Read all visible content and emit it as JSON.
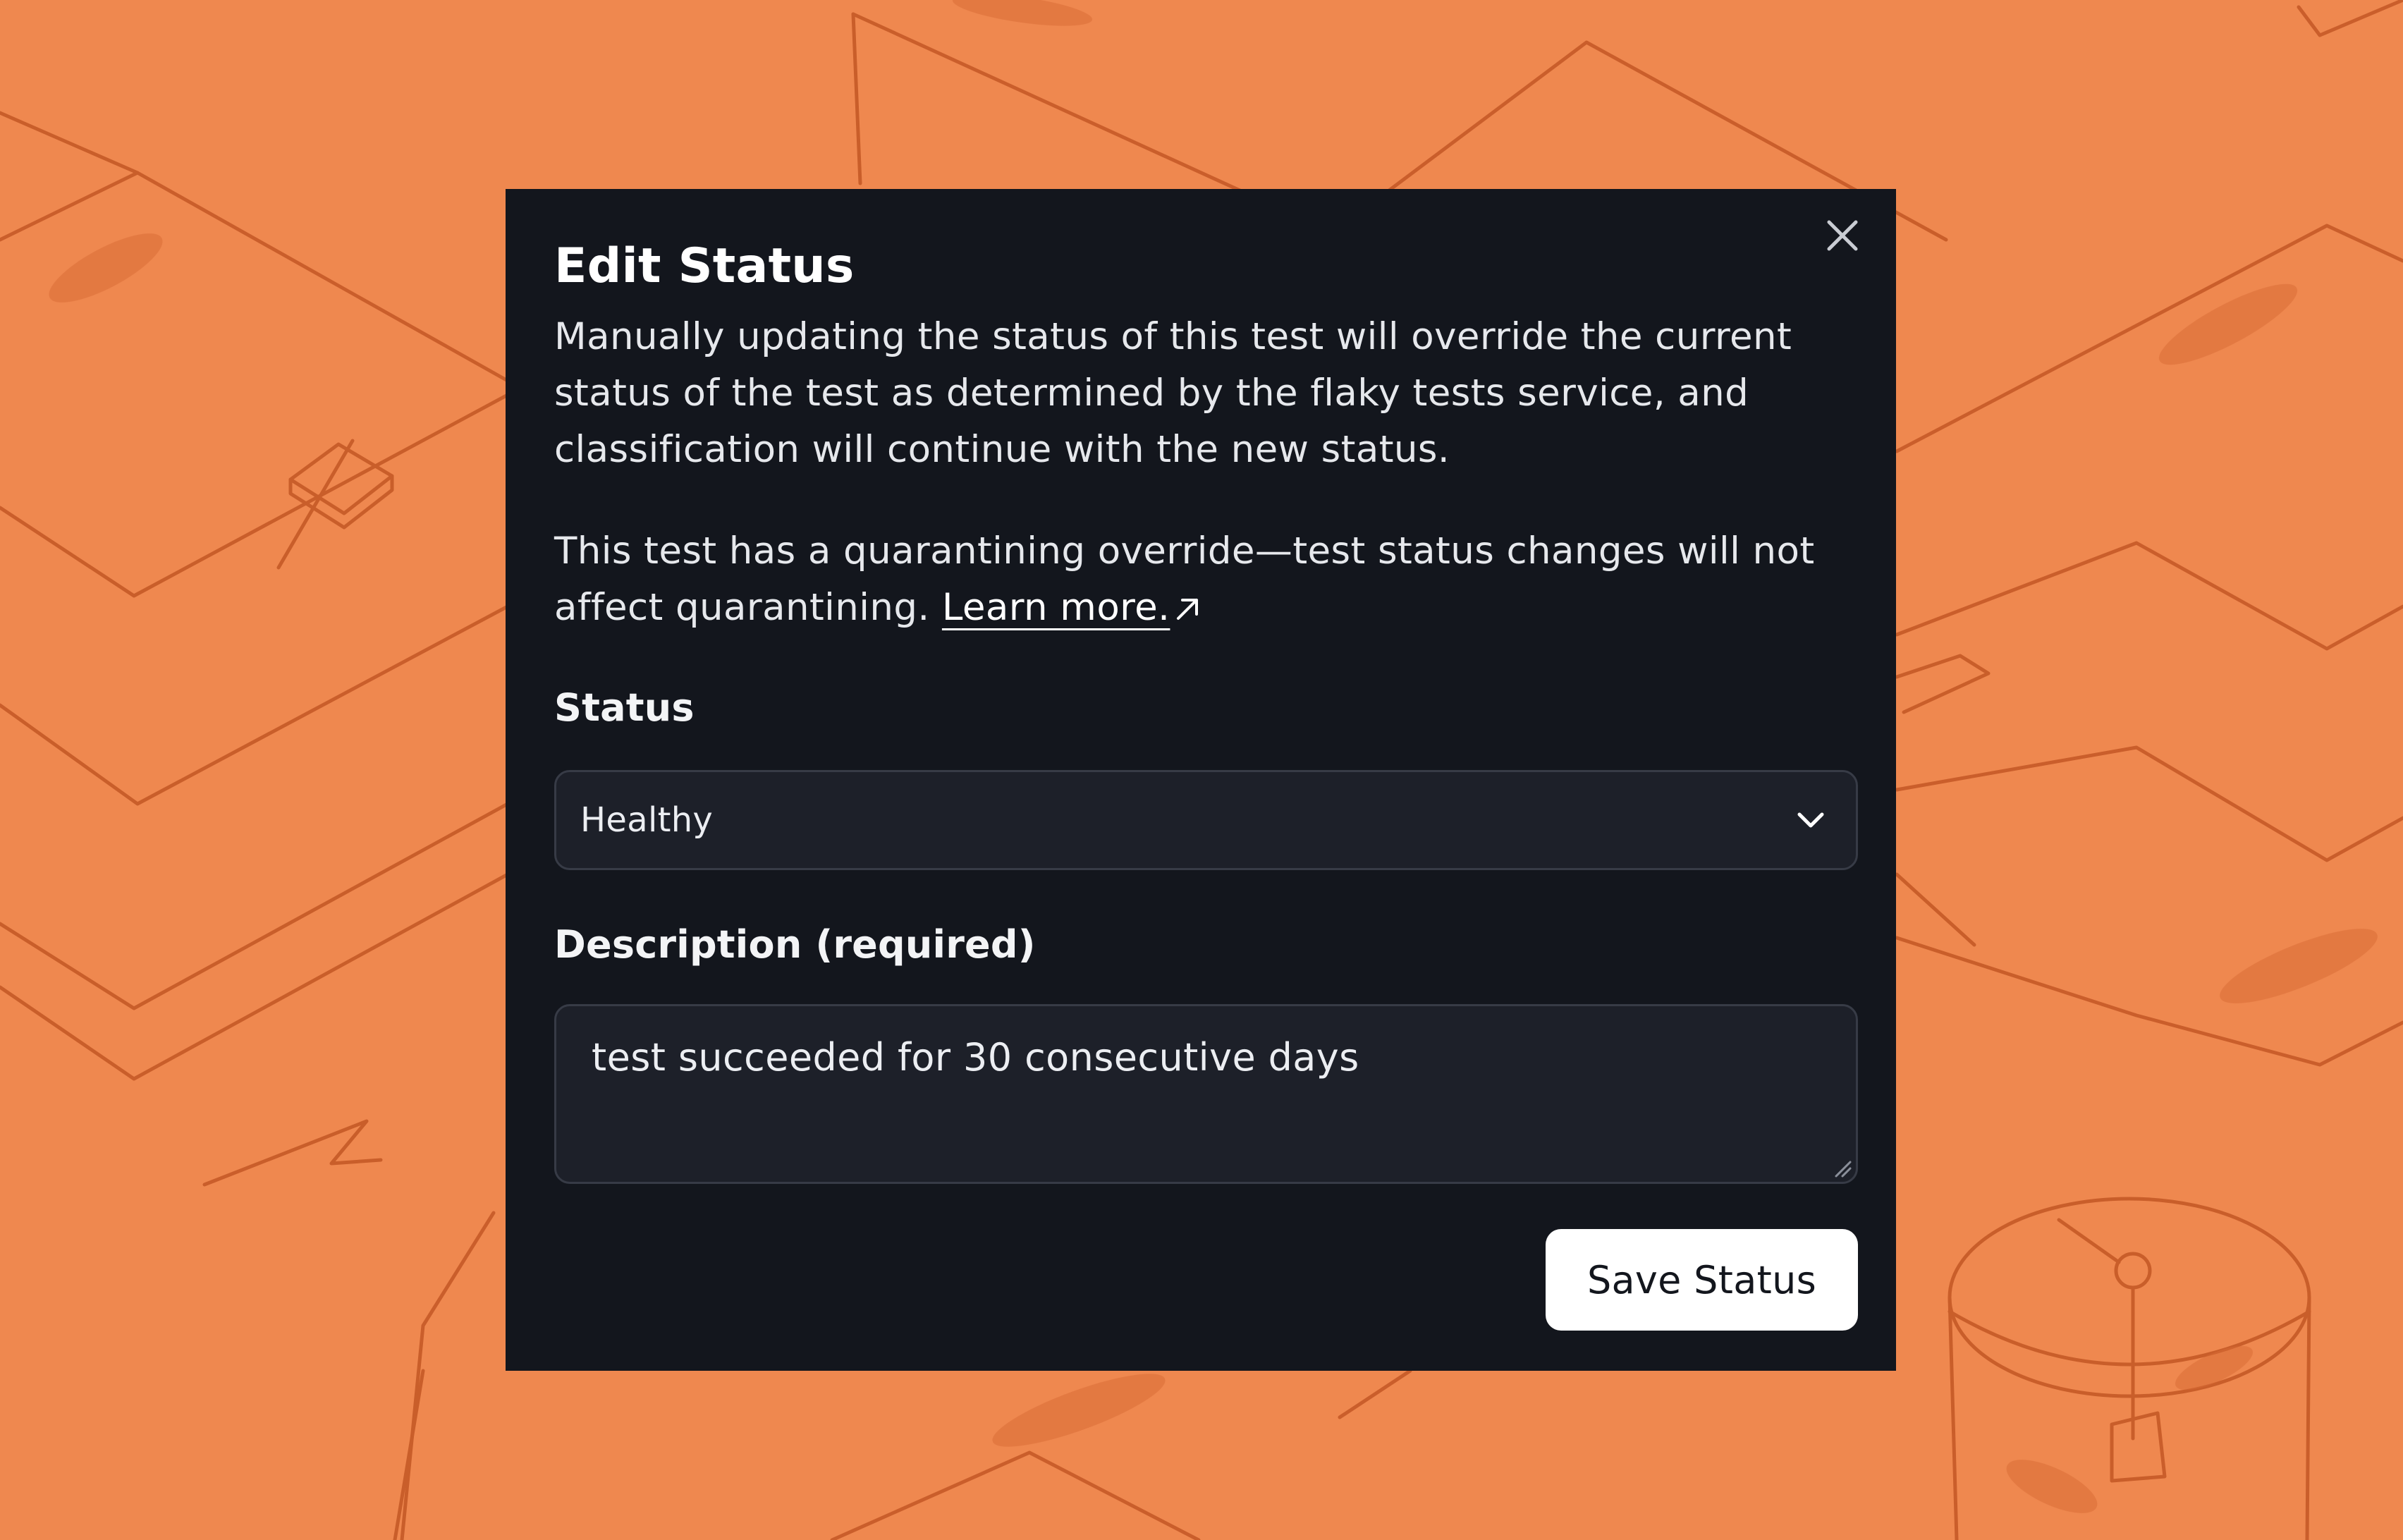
{
  "colors": {
    "background": "#ef884f",
    "sketch_lines": "#c75a28",
    "modal_background": "#13161d",
    "field_background": "#1d2029",
    "field_border": "#373b46",
    "button_background": "#ffffff",
    "text_primary": "#ffffff"
  },
  "modal": {
    "title": "Edit Status",
    "close_icon": "close-icon",
    "paragraph_1": "Manually updating the status of this test will override the current status of the test as determined by the flaky tests service, and classification will continue with the new status.",
    "paragraph_2_text": "This test has a quarantining override—test status changes will not affect quarantining.",
    "learn_more_label": "Learn more.",
    "learn_more_icon": "arrow-up-right-icon"
  },
  "status_field": {
    "label": "Status",
    "selected": "Healthy",
    "chevron_icon": "chevron-down-icon"
  },
  "description_field": {
    "label": "Description (required)",
    "value": "test succeeded for 30 consecutive days"
  },
  "actions": {
    "save_label": "Save Status"
  }
}
